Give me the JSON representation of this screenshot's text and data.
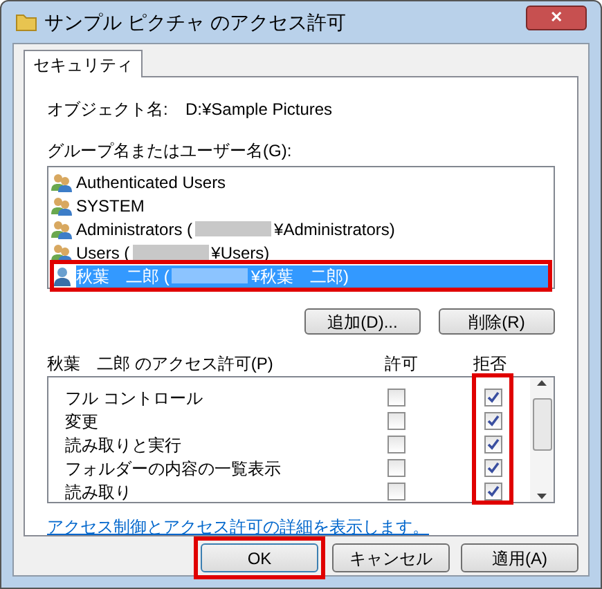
{
  "window": {
    "title": "サンプル ピクチャ のアクセス許可",
    "close": "✕"
  },
  "tabs": [
    {
      "label": "セキュリティ",
      "selected": true
    }
  ],
  "object_name": {
    "label": "オブジェクト名:",
    "value": "D:¥Sample Pictures"
  },
  "groups": {
    "label": "グループ名またはユーザー名(G):",
    "items": [
      {
        "kind": "group",
        "before": "Authenticated Users",
        "redacted": false,
        "selected": false,
        "highlighted": false
      },
      {
        "kind": "group",
        "before": "SYSTEM",
        "redacted": false,
        "selected": false,
        "highlighted": false
      },
      {
        "kind": "group",
        "before": "Administrators (",
        "redacted": true,
        "after": "¥Administrators)",
        "selected": false,
        "highlighted": false
      },
      {
        "kind": "group",
        "before": "Users (",
        "redacted": true,
        "after": "¥Users)",
        "selected": false,
        "highlighted": false
      },
      {
        "kind": "user",
        "before": "秋葉　二郎 (",
        "redacted": true,
        "after": "¥秋葉　二郎)",
        "selected": true,
        "highlighted": true
      }
    ]
  },
  "group_buttons": [
    "追加(D)...",
    "削除(R)"
  ],
  "permissions": {
    "label": "秋葉　二郎 のアクセス許可(P)",
    "allow_header": "許可",
    "deny_header": "拒否",
    "deny_highlighted": true,
    "rows": [
      {
        "name": "フル コントロール",
        "allow": false,
        "deny": true
      },
      {
        "name": "変更",
        "allow": false,
        "deny": true
      },
      {
        "name": "読み取りと実行",
        "allow": false,
        "deny": true
      },
      {
        "name": "フォルダーの内容の一覧表示",
        "allow": false,
        "deny": true
      },
      {
        "name": "読み取り",
        "allow": false,
        "deny": true
      }
    ]
  },
  "link": "アクセス制御とアクセス許可の詳細を表示します。",
  "buttons": [
    {
      "label": "OK",
      "highlighted": true
    },
    {
      "label": "キャンセル",
      "highlighted": false
    },
    {
      "label": "適用(A)",
      "highlighted": false
    }
  ]
}
